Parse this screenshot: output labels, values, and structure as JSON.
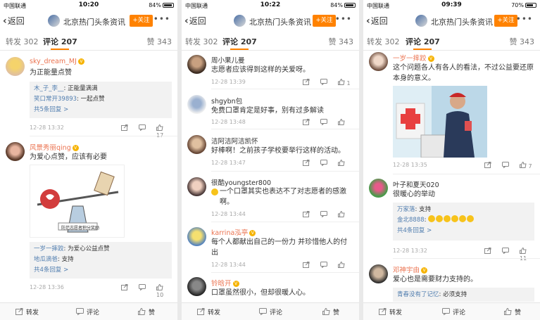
{
  "panels": [
    {
      "status": {
        "carrier": "中国联通",
        "time": "10:20",
        "battery": "84%",
        "battery_level": 0.84
      },
      "nav": {
        "back": "返回",
        "title": "北京热门头条资讯",
        "follow": "+关注"
      },
      "tabs": {
        "repost": "转发 302",
        "comment": "评论 207",
        "like": "赞 343"
      },
      "comments": [
        {
          "user": "sky_dream_MJ",
          "text": "为正能量点赞",
          "replies": [
            {
              "user": "木_子_李__",
              "text": ": 正能量满满"
            },
            {
              "user": "笑口常开39893",
              "text": ": 一起点赞"
            }
          ],
          "more": "共5条回复 >",
          "time": "12-28 13:32",
          "likes": "17"
        },
        {
          "user": "风景秀丽qing",
          "text": "为爱心点赞，应该有必要",
          "image_caption": "防范志愿者积分奖励",
          "replies": [
            {
              "user": "一岁一摔跤",
              "text": ": 为爱心公益点赞"
            },
            {
              "user": "地瓜滴爸",
              "text": ": 支持"
            }
          ],
          "more": "共4条回复 >",
          "time": "12-28 13:36",
          "likes": "10"
        }
      ],
      "bottom": {
        "repost": "转发",
        "comment": "评论",
        "like": "赞"
      }
    },
    {
      "status": {
        "carrier": "中国联通",
        "time": "10:22",
        "battery": "84%",
        "battery_level": 0.84
      },
      "nav": {
        "back": "返回",
        "title": "北京热门头条资讯",
        "follow": "+关注"
      },
      "tabs": {
        "repost": "转发 302",
        "comment": "评论 207",
        "like": "赞 343"
      },
      "comments": [
        {
          "user": "周小果儿曼",
          "text": "志愿者应该得到这样的关爱呀。",
          "time": "12-28 13:39",
          "likes": "1"
        },
        {
          "user": "shgybn包",
          "text": "免费口罩肯定是好事，别有过多解读",
          "time": "12-28 13:48",
          "likes": ""
        },
        {
          "user": "洁阿洁阿洁凯怀",
          "text": "好棒啊！之前孩子学校要举行这样的活动。",
          "time": "12-28 13:47",
          "likes": ""
        },
        {
          "user": "很酷youngster800",
          "text": "一个口罩其实也表达不了对志愿者的感激啊。",
          "time": "12-28 13:44",
          "likes": ""
        },
        {
          "user": "karrina泓亭",
          "text": "每个人都献出自己的一份力 并珍惜他人的付出",
          "time": "12-28 13:44",
          "likes": ""
        },
        {
          "user": "铃晗开",
          "text": "口罩虽然很小，但却很暖人心。"
        }
      ],
      "bottom": {
        "repost": "转发",
        "comment": "评论",
        "like": "赞"
      }
    },
    {
      "status": {
        "carrier": "中国联通",
        "time": "09:39",
        "battery": "70%",
        "battery_level": 0.7
      },
      "nav": {
        "back": "返回",
        "title": "北京热门头条资讯",
        "follow": "+关注"
      },
      "tabs": {
        "repost": "转发 302",
        "comment": "评论 207",
        "like": "赞 343"
      },
      "comments": [
        {
          "user": "一岁一摔跤",
          "text": "这个问题各人有各人的看法，不过公益要还原本身的意义。",
          "time": "12-28 13:35",
          "likes": "7"
        },
        {
          "user": "叶子和夏天020",
          "text": "很暖心的举动",
          "replies": [
            {
              "user": "万家落",
              "text": ": 支持"
            },
            {
              "user": "金北8888",
              "text": ": "
            }
          ],
          "more": "共4条回复 >",
          "time": "12-28 13:32",
          "likes": "11"
        },
        {
          "user": "邓神宇由",
          "text": "爱心也是需要财力支持的。",
          "replies": [
            {
              "user": "青春没有了记忆",
              "text": ": 必须支持"
            }
          ]
        }
      ],
      "bottom": {
        "repost": "转发",
        "comment": "评论",
        "like": "赞"
      }
    }
  ],
  "colors": {
    "accent": "#ff8200",
    "link": "#507daf",
    "username": "#eb7350"
  }
}
